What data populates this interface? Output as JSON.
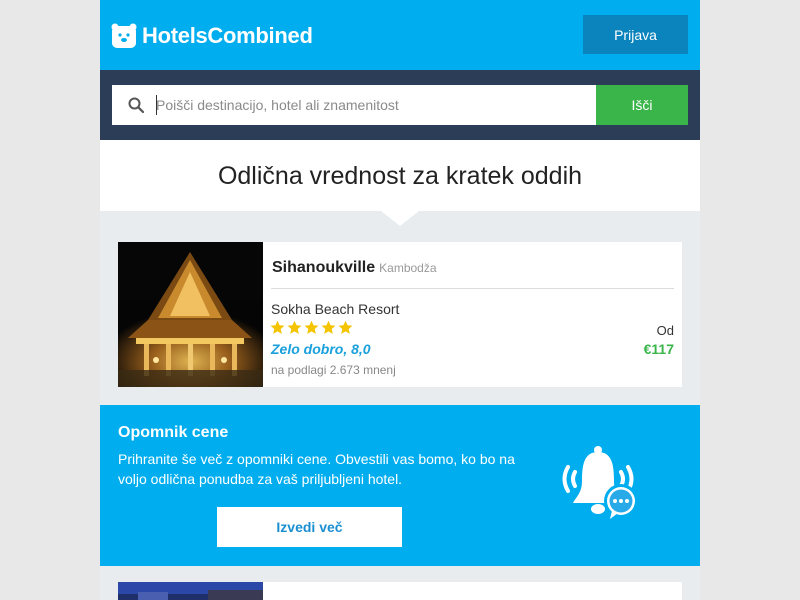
{
  "header": {
    "logo_text": "HotelsCombined",
    "login_label": "Prijava"
  },
  "search": {
    "placeholder": "Poišči destinacijo, hotel ali znamenitost",
    "button_label": "Išči"
  },
  "section_title": "Odlična vrednost za kratek oddih",
  "deal": {
    "city": "Sihanoukville",
    "country": "Kambodža",
    "hotel": "Sokha Beach Resort",
    "stars": 5,
    "rating_text": "Zelo dobro, 8,0",
    "reviews_text": "na podlagi 2.673 mnenj",
    "from_label": "Od",
    "price": "€117"
  },
  "price_alert": {
    "title": "Opomnik cene",
    "body": "Prihranite še več z opomniki cene. Obvestili vas bomo, ko bo na voljo odlična ponudba za vaš priljubljeni hotel.",
    "button_label": "Izvedi več"
  },
  "colors": {
    "brand_blue": "#00aeef",
    "search_bg": "#2c3e57",
    "search_button": "#3ab54a",
    "star": "#f5c400",
    "price": "#3ab54a"
  }
}
